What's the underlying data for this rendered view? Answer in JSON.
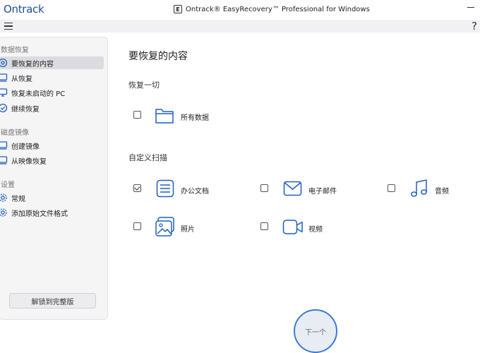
{
  "window": {
    "logo": "Ontrack",
    "title": "Ontrack® EasyRecovery™ Professional for Windows",
    "help": "?"
  },
  "sidebar": {
    "sections": [
      {
        "label": "数据恢复",
        "items": [
          "要恢复的内容",
          "从恢复",
          "恢复未启动的 PC",
          "继续恢复"
        ]
      },
      {
        "label": "磁盘镜像",
        "items": [
          "创建镜像",
          "从映像恢复"
        ]
      },
      {
        "label": "设置",
        "items": [
          "常规",
          "添加原始文件格式"
        ]
      }
    ],
    "unlock_label": "解锁到完整版"
  },
  "main": {
    "title": "要恢复的内容",
    "recover_all": {
      "heading": "恢复一切",
      "option": "所有数据",
      "checked": false
    },
    "custom_scan": {
      "heading": "自定义扫描",
      "options": [
        {
          "label": "办公文档",
          "checked": true,
          "icon": "document-icon"
        },
        {
          "label": "电子邮件",
          "checked": false,
          "icon": "mail-icon"
        },
        {
          "label": "音频",
          "checked": false,
          "icon": "music-icon"
        },
        {
          "label": "照片",
          "checked": false,
          "icon": "photo-icon"
        },
        {
          "label": "视频",
          "checked": false,
          "icon": "video-icon"
        }
      ]
    },
    "next_label": "下一个"
  },
  "colors": {
    "accent": "#2a78d6",
    "icon_blue": "#1f5fbf"
  }
}
